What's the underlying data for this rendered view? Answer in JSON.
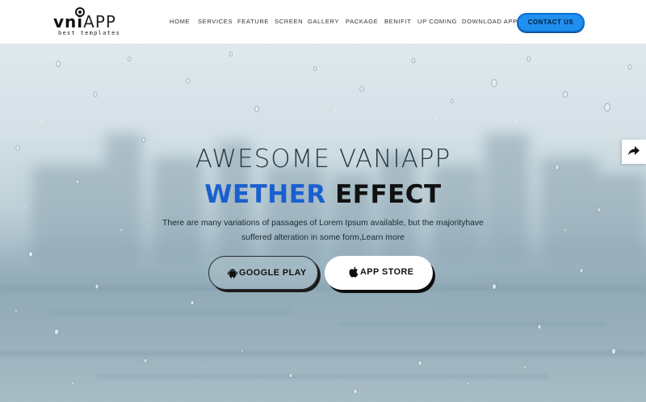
{
  "header": {
    "logo": {
      "main_bold": "vni",
      "main_light": "APP",
      "tagline": "best templates"
    },
    "nav": [
      "HOME",
      "SERVICES",
      "FEATURE",
      "SCREEN",
      "GALLERY",
      "PACKAGE",
      "BENIFIT",
      "UP COMING",
      "DOWNLOAD APP"
    ],
    "contact_label": "CONTACT US"
  },
  "hero": {
    "title": "AWESOME VANIAPP",
    "subtitle_blue": "WETHER",
    "subtitle_dark": "EFFECT",
    "description": "There are many variations of passages of Lorem Ipsum available, but the majorityhave suffered alteration in some form,Learn more",
    "google_play_label": "GOOGLE PLAY",
    "app_store_label": "APP STORE"
  },
  "icons": {
    "google": "android-icon",
    "apple": "apple-icon",
    "share": "share-arrow-icon"
  },
  "colors": {
    "accent_blue": "#1f8ff0",
    "title_blue": "#1a5fcf"
  }
}
